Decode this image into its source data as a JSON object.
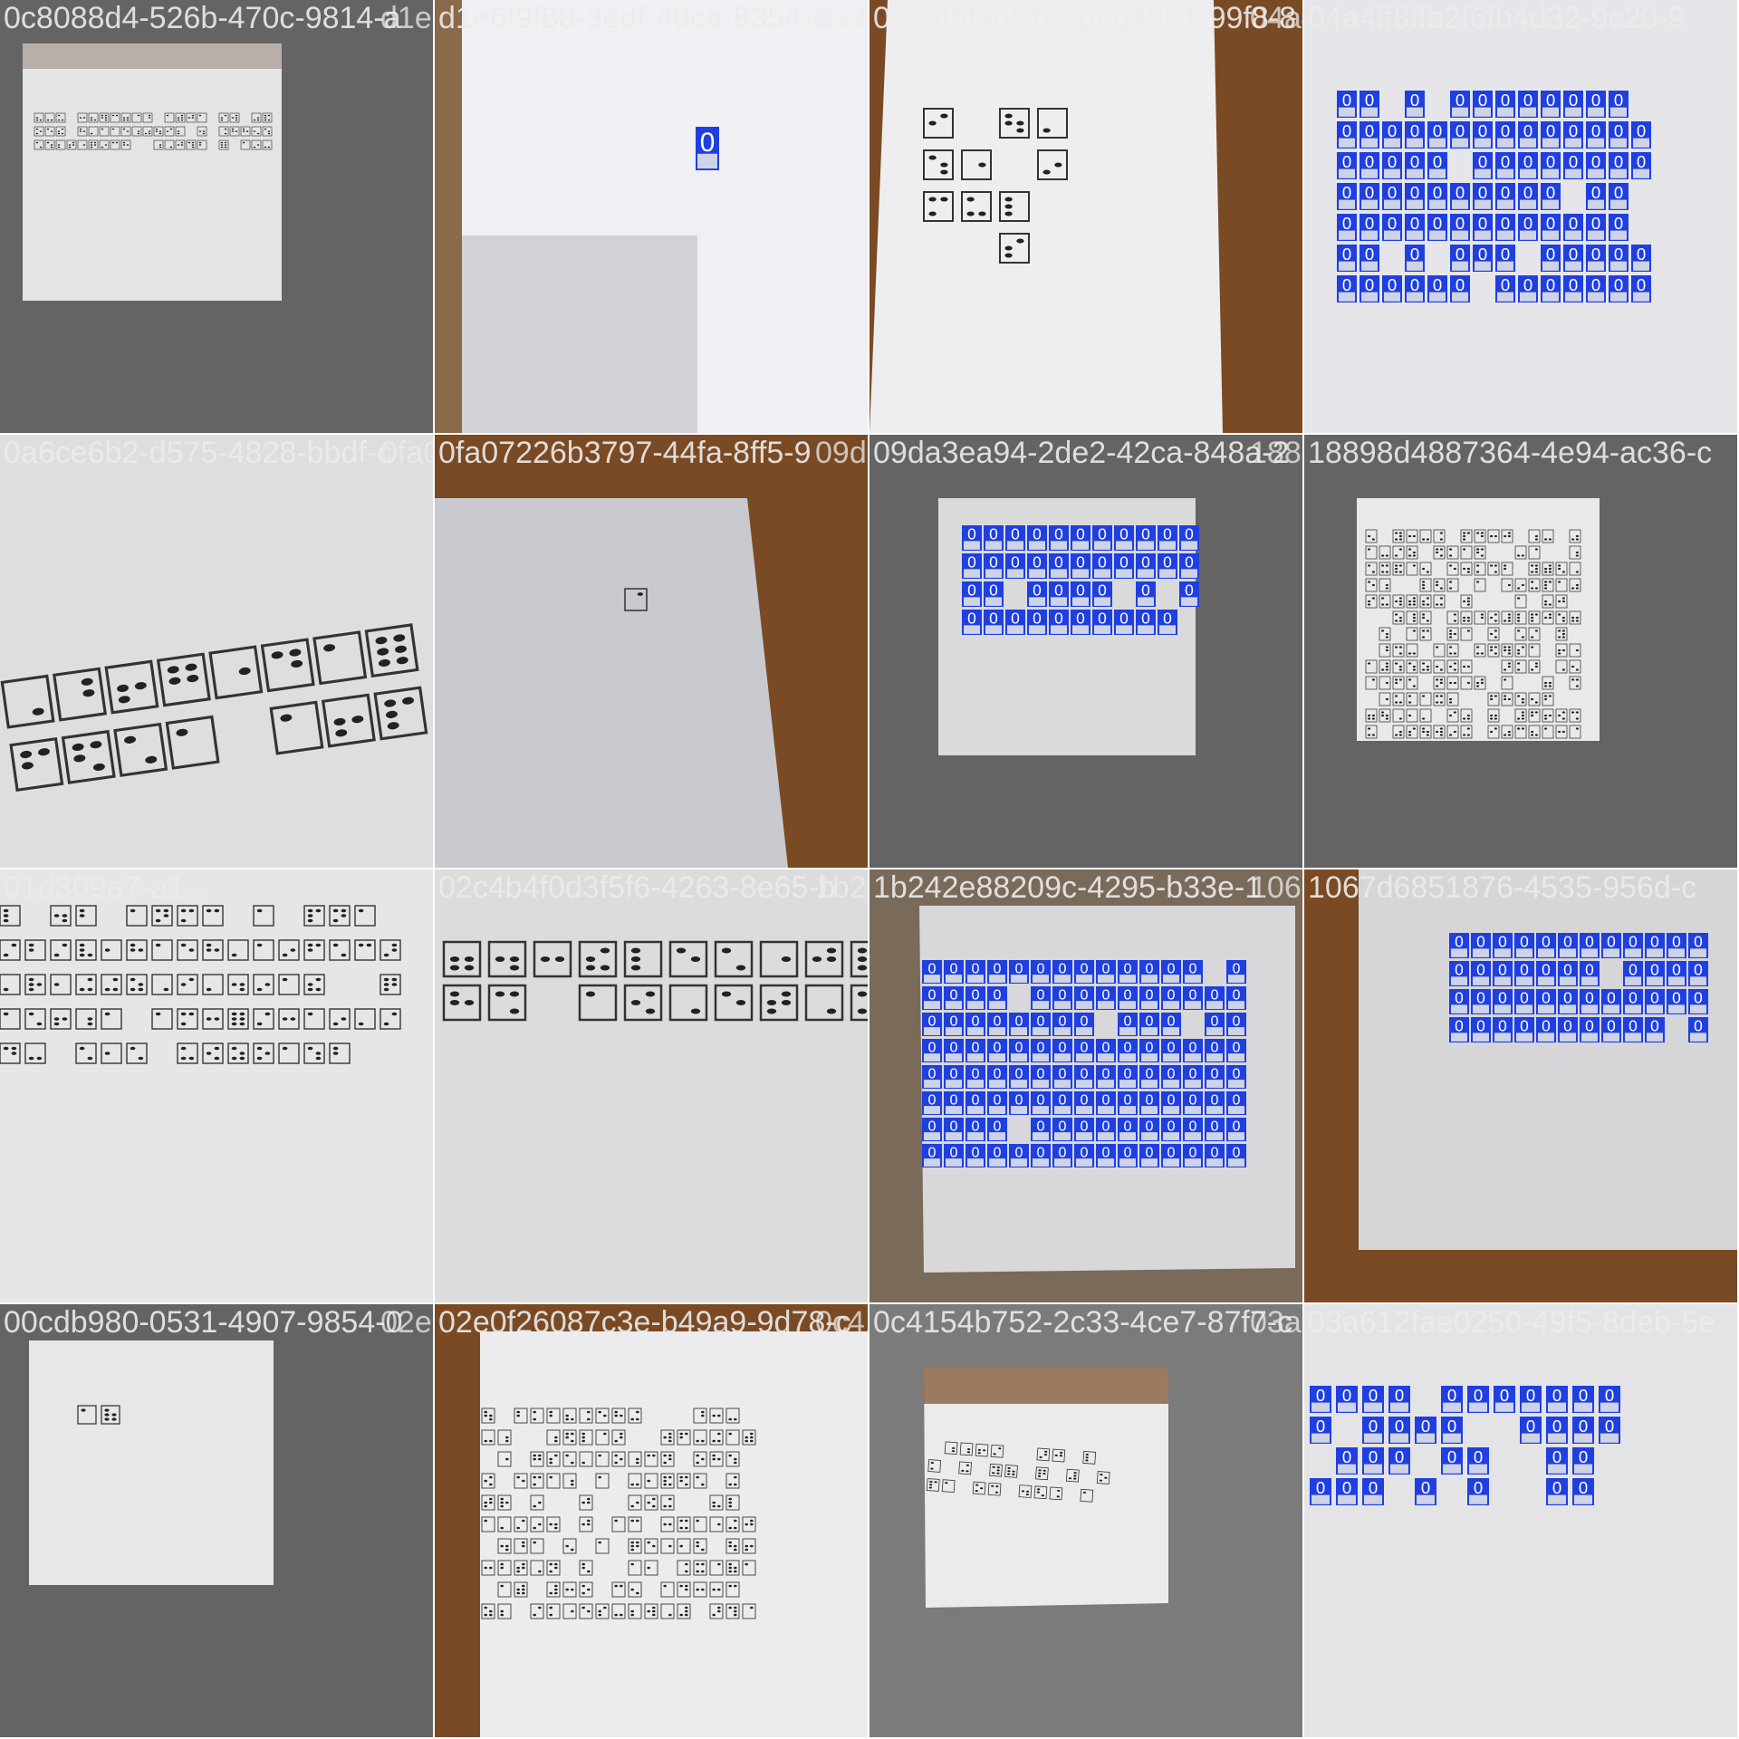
{
  "mosaic": {
    "tiles": [
      {
        "name": "0c8088d4-526b-470c-9814-a...",
        "label": "0c8088d4-526b-470c-9814-a",
        "overlap": "d1e6f9f88-3edf-40ca-8354-a",
        "boxed": false
      },
      {
        "name": "d1e6f9f88-3edf-40ca-8354-a...",
        "label": "d1e6f9f88-3edf-40ca-8354-a",
        "overlap": "0a3af5fa6816_png",
        "boxed": true
      },
      {
        "name": "0a3af5fa6816...",
        "label": "0a3af5fa6816_png48b1-99f8-8",
        "overlap": "04a4ff8ffb2f6fb4d32-9c20-9",
        "boxed": false
      },
      {
        "name": "04a4ff8ffb2f6...",
        "label": "04a4ff8ffb2f6fb4d32-9c20-9",
        "overlap": "",
        "boxed": true
      },
      {
        "name": "0a6ce6b2-d575-4828-bbdf-c...",
        "label": "0a6ce6b2-d575-4828-bbdf-c",
        "overlap": "0fa07226b3797-44fa-8ff5-9",
        "boxed": false
      },
      {
        "name": "0fa07226b...",
        "label": "0fa07226b3797-44fa-8ff5-9",
        "overlap": "09da3ea94-2de2-42ca-848a-2",
        "boxed": false
      },
      {
        "name": "09da3ea94...",
        "label": "09da3ea94-2de2-42ca-848a-2",
        "overlap": "18898d4887364-4e94-ac36-c",
        "boxed": true
      },
      {
        "name": "18898d48...",
        "label": "18898d4887364-4e94-ac36-c",
        "overlap": "",
        "boxed": false
      },
      {
        "name": "01d309a7...",
        "label": "01d309a7-a1...",
        "overlap": "",
        "boxed": false
      },
      {
        "name": "02c4b4f0d...",
        "label": "02c4b4f0d3f5f6-4263-8e65-b",
        "overlap": "1b242e88209cp4295-b33e-1",
        "boxed": false
      },
      {
        "name": "1b242e88...",
        "label": "1b242e88209c-4295-b33e-1",
        "overlap": "1067d6851876-4535-956d-c",
        "boxed": true
      },
      {
        "name": "1067d685...",
        "label": "1067d6851876-4535-956d-c",
        "overlap": "",
        "boxed": true
      },
      {
        "name": "00cdb980-0531-4907-9854-0...",
        "label": "00cdb980-0531-4907-9854-0",
        "overlap": "02e0f26087c3e-b49a9-9d78-c",
        "boxed": false
      },
      {
        "name": "02e0f260...",
        "label": "02e0f26087c3e-b49a9-9d78-c",
        "overlap": "0c4154b752-2c33-4ce7-87f7-c",
        "boxed": false
      },
      {
        "name": "0c4154b7...",
        "label": "0c4154b752-2c33-4ce7-87f7-c",
        "overlap": "03a612fae0250-49f5-8deb-5e",
        "boxed": false
      },
      {
        "name": "03a612fa...",
        "label": "03a612fae0250-49f5-8deb-5e",
        "overlap": "",
        "boxed": true
      }
    ],
    "box_class_label": "0",
    "colors": {
      "background": "#646464",
      "paper": "#e9e9ec",
      "box": "#1f3fe0",
      "label_text": "#ececec",
      "wood": "#7a4a24",
      "dot": "#222222"
    }
  }
}
